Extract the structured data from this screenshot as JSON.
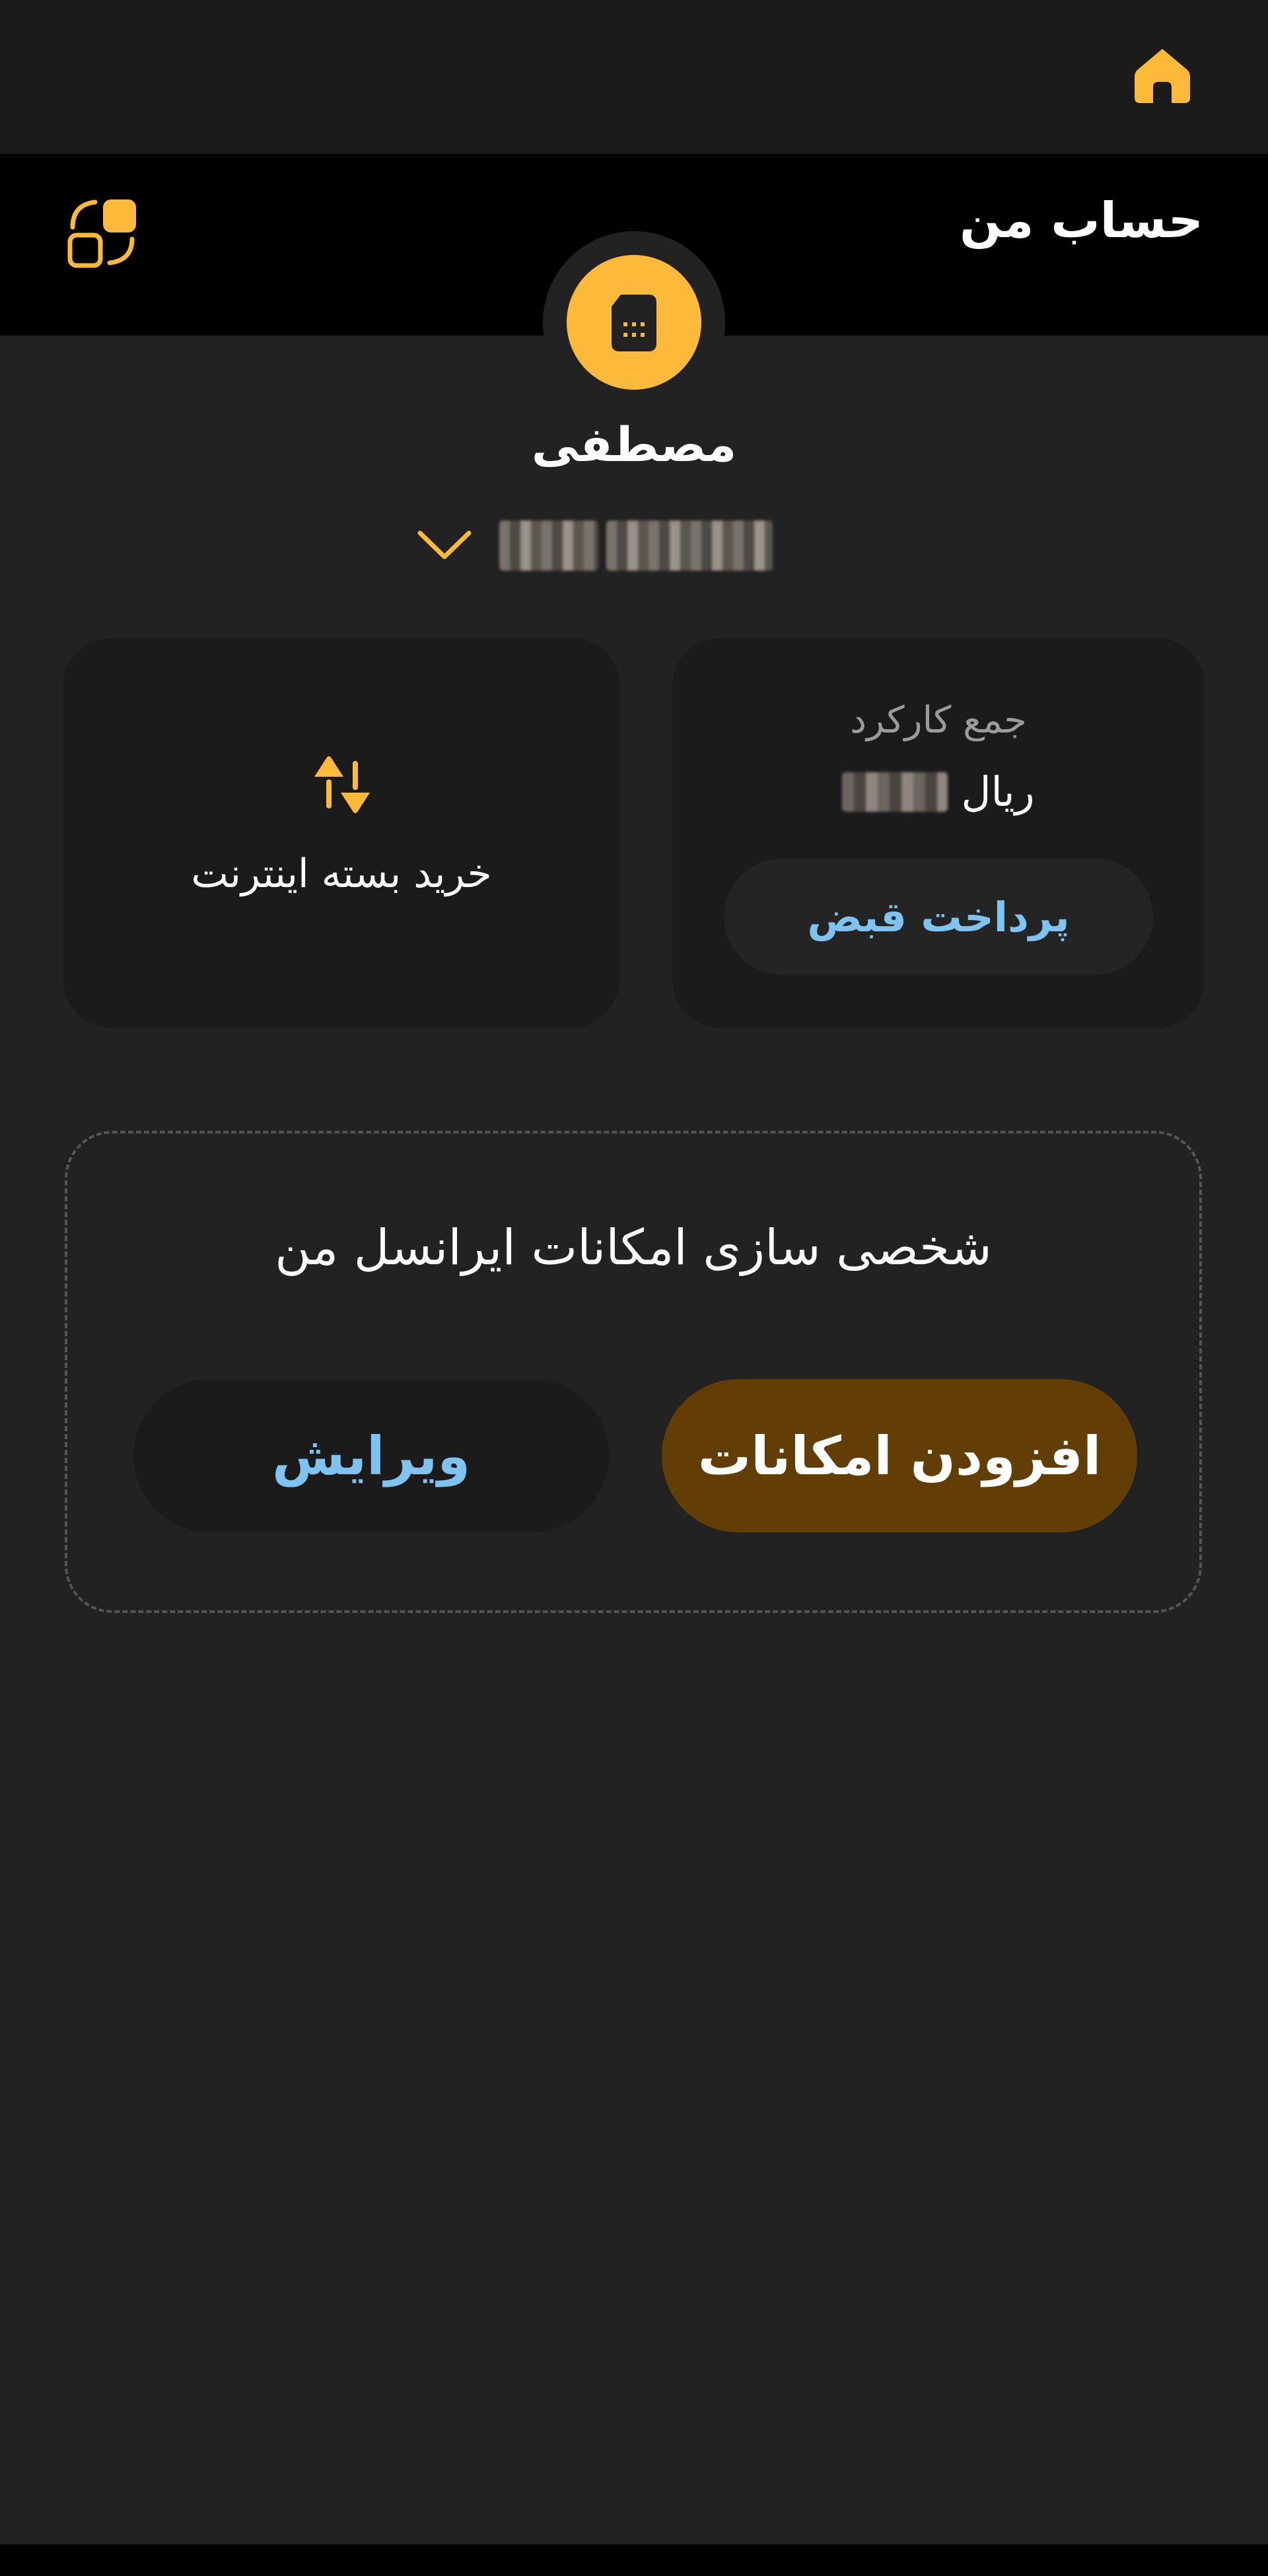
{
  "header": {
    "title": "حساب من"
  },
  "profile": {
    "name": "مصطفی"
  },
  "usage_card": {
    "label": "جمع کارکرد",
    "currency": "ریال",
    "pay_button": "پرداخت قبض"
  },
  "internet_card": {
    "label": "خرید بسته اینترنت"
  },
  "customize": {
    "title": "شخصی سازی امکانات ایرانسل من",
    "add_button": "افزودن امکانات",
    "edit_button": "ویرایش"
  },
  "colors": {
    "accent": "#fdba3a",
    "link": "#7fc3f0",
    "add_button_bg": "#633d06"
  },
  "icons": {
    "home": "home-icon",
    "apps": "apps-icon",
    "sim": "sim-card-icon",
    "expand": "chevron-down-icon",
    "data": "data-transfer-icon"
  }
}
